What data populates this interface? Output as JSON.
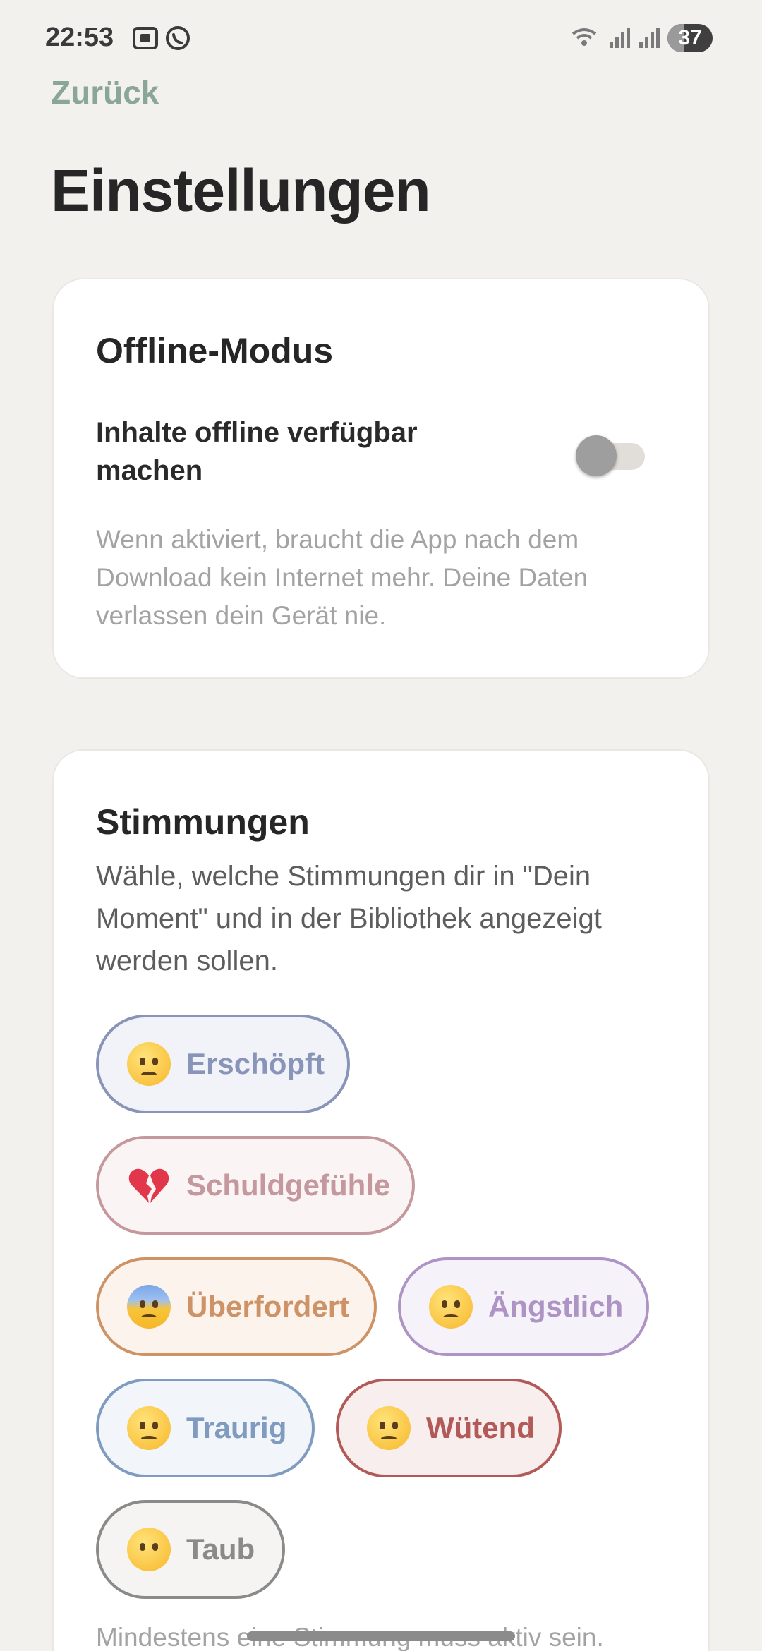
{
  "status": {
    "time": "22:53",
    "battery": "37",
    "battery_level": 0.37
  },
  "nav": {
    "back_label": "Zurück"
  },
  "page": {
    "title": "Einstellungen"
  },
  "offline": {
    "title": "Offline-Modus",
    "toggle_label": "Inhalte offline verfügbar machen",
    "toggle_on": false,
    "helper": "Wenn aktiviert, braucht die App nach dem Download kein Internet mehr. Deine Daten verlassen dein Gerät nie."
  },
  "moods": {
    "title": "Stimmungen",
    "description": "Wähle, welche Stimmungen dir in \"Dein Moment\" und in der Bibliothek angezeigt werden sollen.",
    "items": [
      {
        "label": "Erschöpft",
        "icon": "tired-face-icon",
        "color": "#8895b8",
        "bg": "#f1f3f8"
      },
      {
        "label": "Schuldgefühle",
        "icon": "broken-heart-icon",
        "color": "#c4989c",
        "bg": "#faf4f4"
      },
      {
        "label": "Überfordert",
        "icon": "anxious-sweat-face-icon",
        "color": "#cd9366",
        "bg": "#fcf3ec"
      },
      {
        "label": "Ängstlich",
        "icon": "worried-face-icon",
        "color": "#ae94c4",
        "bg": "#f6f2f9"
      },
      {
        "label": "Traurig",
        "icon": "crying-face-icon",
        "color": "#7f9cc0",
        "bg": "#f2f5f9"
      },
      {
        "label": "Wütend",
        "icon": "angry-face-icon",
        "color": "#b25a58",
        "bg": "#f8eeed"
      },
      {
        "label": "Taub",
        "icon": "no-mouth-face-icon",
        "color": "#8a8a8a",
        "bg": "#f5f4f2"
      }
    ],
    "footer": "Mindestens eine Stimmung muss aktiv sein."
  }
}
